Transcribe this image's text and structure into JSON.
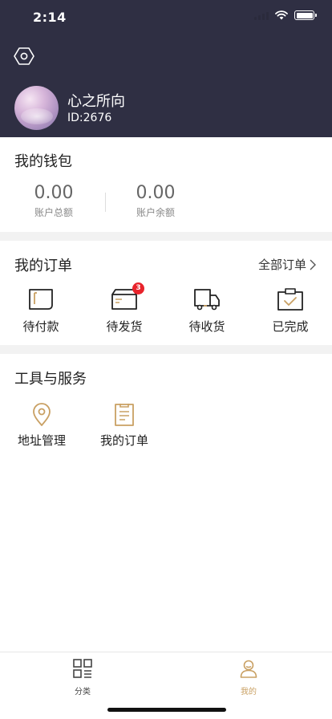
{
  "status_bar": {
    "time": "2:14"
  },
  "colors": {
    "header_bg": "#2f2f43",
    "accent": "#c9a063",
    "badge": "#e8232b"
  },
  "profile": {
    "name": "心之所向",
    "id_text": "ID:2676"
  },
  "wallet": {
    "title": "我的钱包",
    "total": {
      "value": "0.00",
      "label": "账户总额"
    },
    "balance": {
      "value": "0.00",
      "label": "账户余额"
    }
  },
  "orders": {
    "title": "我的订单",
    "all_label": "全部订单",
    "items": [
      {
        "label": "待付款",
        "icon": "wallet-icon"
      },
      {
        "label": "待发货",
        "icon": "box-icon",
        "badge": "3"
      },
      {
        "label": "待收货",
        "icon": "truck-icon"
      },
      {
        "label": "已完成",
        "icon": "clipboard-check-icon"
      }
    ]
  },
  "tools": {
    "title": "工具与服务",
    "items": [
      {
        "label": "地址管理",
        "icon": "location-pin-icon"
      },
      {
        "label": "我的订单",
        "icon": "document-icon"
      }
    ]
  },
  "tabbar": {
    "items": [
      {
        "label": "分类",
        "icon": "category-icon",
        "active": false
      },
      {
        "label": "我的",
        "icon": "user-icon",
        "active": true
      }
    ]
  }
}
